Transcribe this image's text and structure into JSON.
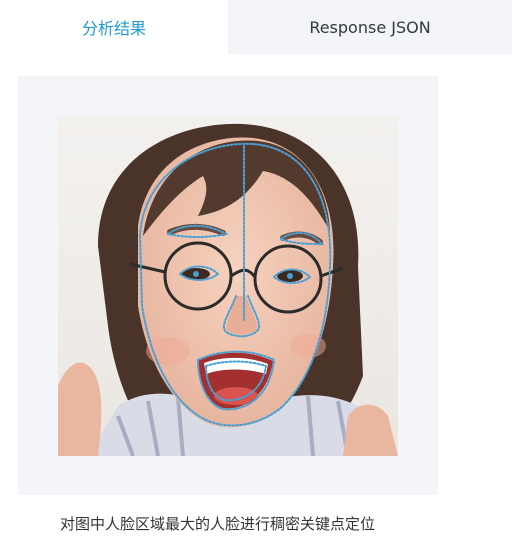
{
  "tabs": [
    {
      "label": "分析结果",
      "active": true
    },
    {
      "label": "Response JSON",
      "active": false
    }
  ],
  "result": {
    "image_alt": "girl with glasses smiling, face landmarks overlay",
    "caption": "对图中人脸区域最大的人脸进行稠密关键点定位",
    "landmark_color": "#4a9fd4",
    "accent_color": "#1f9bd1"
  }
}
